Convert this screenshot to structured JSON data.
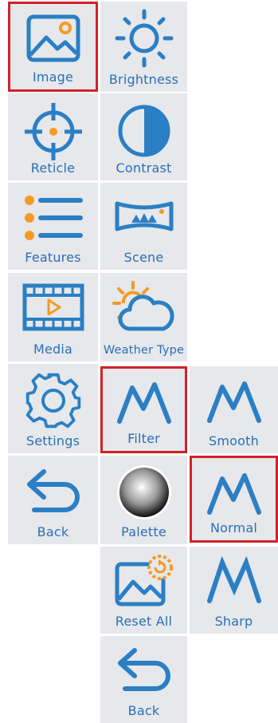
{
  "colors": {
    "tile_bg": "#e6e8eb",
    "icon_blue": "#2b7fc4",
    "accent_orange": "#f59a23",
    "selection_red": "#d4202a"
  },
  "menu": {
    "col1": [
      {
        "label": "Image",
        "icon": "image-icon",
        "selected": true
      },
      {
        "label": "Reticle",
        "icon": "reticle-icon",
        "selected": false
      },
      {
        "label": "Features",
        "icon": "features-list-icon",
        "selected": false
      },
      {
        "label": "Media",
        "icon": "media-film-icon",
        "selected": false
      },
      {
        "label": "Settings",
        "icon": "gear-icon",
        "selected": false
      },
      {
        "label": "Back",
        "icon": "back-arrow-icon",
        "selected": false
      }
    ],
    "col2": [
      {
        "label": "Brightness",
        "icon": "sun-icon",
        "selected": false
      },
      {
        "label": "Contrast",
        "icon": "contrast-icon",
        "selected": false
      },
      {
        "label": "Scene",
        "icon": "scene-icon",
        "selected": false
      },
      {
        "label": "Weather Type",
        "icon": "weather-icon",
        "selected": false
      },
      {
        "label": "Filter",
        "icon": "filter-icon",
        "selected": true
      },
      {
        "label": "Palette",
        "icon": "palette-icon",
        "selected": false
      },
      {
        "label": "Reset All",
        "icon": "reset-image-icon",
        "selected": false
      },
      {
        "label": "Back",
        "icon": "back-arrow-icon",
        "selected": false
      }
    ],
    "col3": [
      {
        "label": "Smooth",
        "icon": "smooth-filter-icon",
        "selected": false
      },
      {
        "label": "Normal",
        "icon": "normal-filter-icon",
        "selected": true
      },
      {
        "label": "Sharp",
        "icon": "sharp-filter-icon",
        "selected": false
      }
    ]
  }
}
